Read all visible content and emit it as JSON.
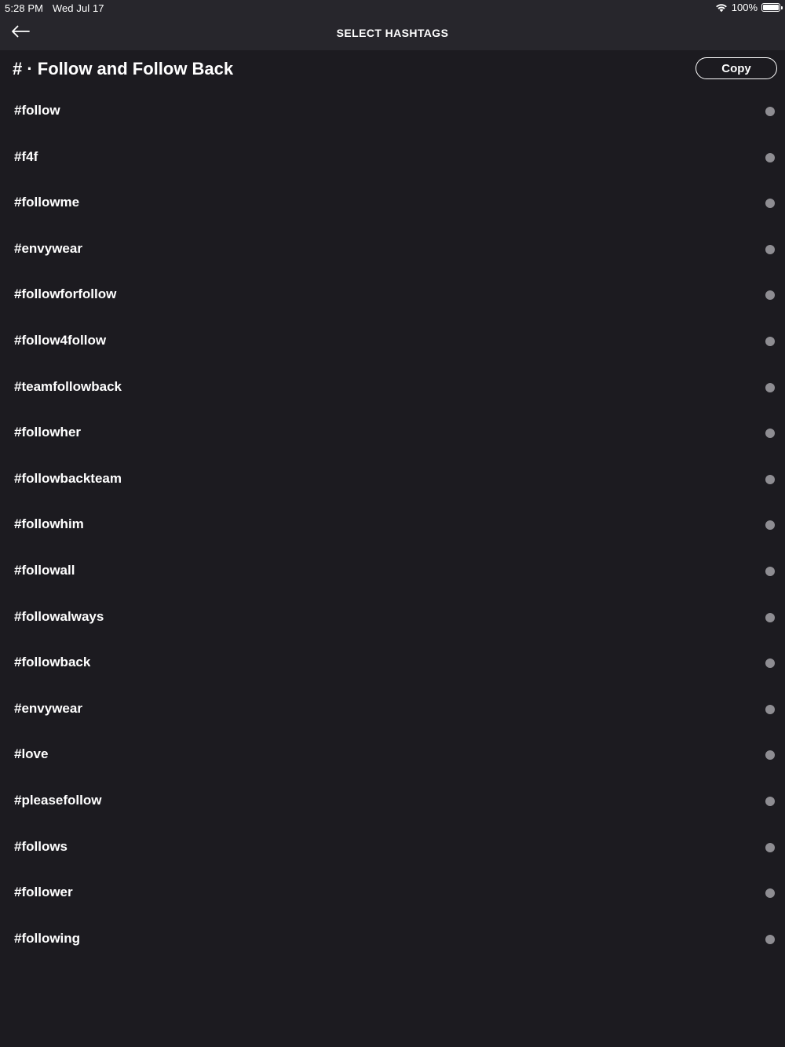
{
  "status_bar": {
    "time": "5:28 PM",
    "date": "Wed Jul 17",
    "battery": "100%"
  },
  "nav": {
    "title": "SELECT HASHTAGS",
    "back_icon": "arrow-left-icon"
  },
  "group": {
    "title": "# · Follow and Follow Back",
    "copy_label": "Copy"
  },
  "hashtags": [
    "#follow",
    "#f4f",
    "#followme",
    "#envywear",
    "#followforfollow",
    "#follow4follow",
    "#teamfollowback",
    "#followher",
    "#followbackteam",
    "#followhim",
    "#followall",
    "#followalways",
    "#followback",
    "#envywear",
    "#love",
    "#pleasefollow",
    "#follows",
    "#follower",
    "#following"
  ],
  "colors": {
    "background": "#1c1b20",
    "bar": "#27262c",
    "dot": "#8e8d92",
    "text": "#ffffff"
  }
}
